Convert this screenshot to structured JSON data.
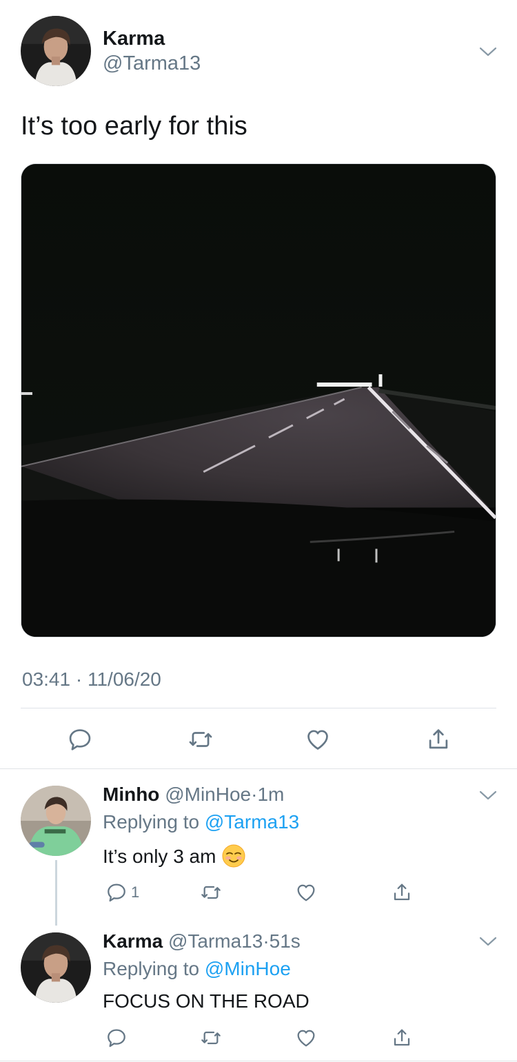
{
  "tweet": {
    "author_name": "Karma",
    "author_handle": "@Tarma13",
    "text": "It’s too early for this",
    "time": "03:41",
    "separator": "·",
    "date": "11/06/20"
  },
  "replies": [
    {
      "name": "Minho",
      "handle": "@MinHoe",
      "dot": "·",
      "age": "1m",
      "replying_prefix": "Replying to",
      "replying_to": "@Tarma13",
      "text": "It’s only 3 am",
      "emoji": "smiling-face-icon",
      "reply_count": "1"
    },
    {
      "name": "Karma",
      "handle": "@Tarma13",
      "dot": "·",
      "age": "51s",
      "replying_prefix": "Replying to",
      "replying_to": "@MinHoe",
      "text": "FOCUS ON THE ROAD"
    }
  ],
  "icons": {
    "reply": "reply-bubble-icon",
    "retweet": "retweet-icon",
    "like": "heart-icon",
    "share": "share-icon",
    "more": "chevron-down-icon"
  },
  "colors": {
    "link": "#1da1f2",
    "secondary_text": "#657786",
    "primary_text": "#14171a",
    "divider": "#dfe3e7"
  }
}
